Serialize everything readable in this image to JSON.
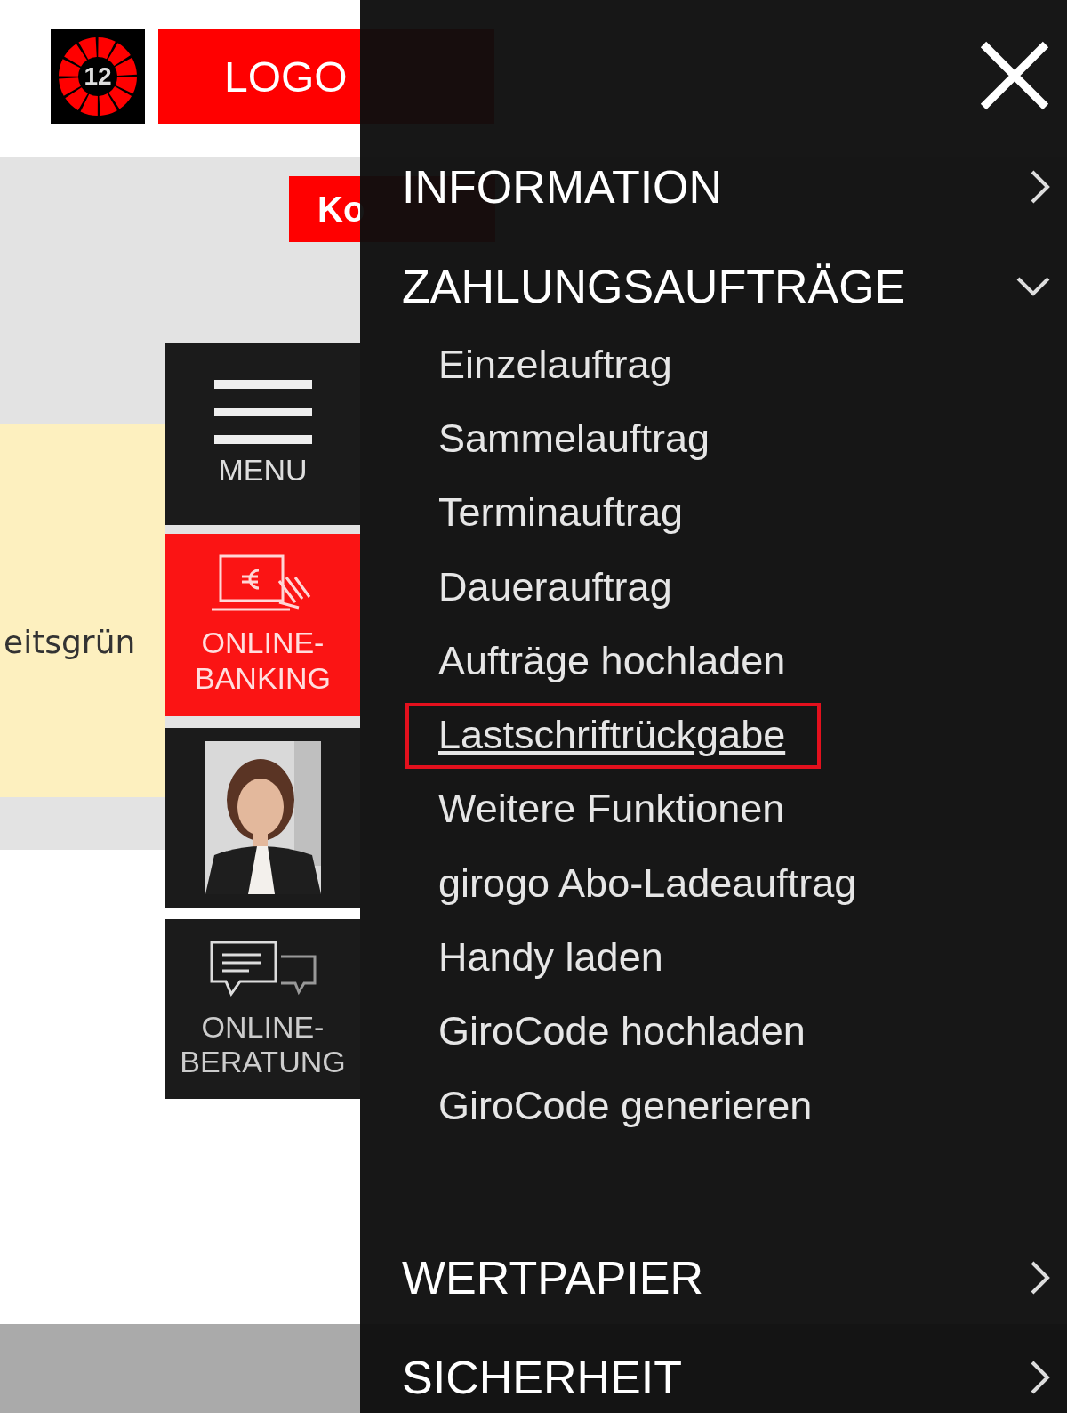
{
  "header": {
    "logo_number": "12",
    "logout_button": "LOGO",
    "accounts_button": "Ko"
  },
  "notice": {
    "text": "eitsgrün"
  },
  "side_tiles": [
    {
      "kind": "menu",
      "label": "MENU"
    },
    {
      "kind": "banking",
      "label": "ONLINE-\nBANKING"
    },
    {
      "kind": "advisor"
    },
    {
      "kind": "chat",
      "label": "ONLINE-\nBERATUNG"
    }
  ],
  "drawer": {
    "sections": [
      {
        "label": "INFORMATION",
        "expanded": false
      },
      {
        "label": "ZAHLUNGSAUFTRÄGE",
        "expanded": true,
        "children": [
          {
            "label": "Einzelauftrag",
            "selected": false
          },
          {
            "label": "Sammelauftrag",
            "selected": false
          },
          {
            "label": "Terminauftrag",
            "selected": false
          },
          {
            "label": "Dauerauftrag",
            "selected": false
          },
          {
            "label": "Aufträge hochladen",
            "selected": false
          },
          {
            "label": "Lastschriftrückgabe",
            "selected": true
          },
          {
            "label": "Weitere Funktionen",
            "selected": false
          },
          {
            "label": "girogo Abo-Ladeauftrag",
            "selected": false
          },
          {
            "label": "Handy laden",
            "selected": false
          },
          {
            "label": "GiroCode hochladen",
            "selected": false
          },
          {
            "label": "GiroCode generieren",
            "selected": false
          }
        ]
      },
      {
        "label": "WERTPAPIER",
        "expanded": false
      },
      {
        "label": "SICHERHEIT",
        "expanded": false
      }
    ]
  }
}
